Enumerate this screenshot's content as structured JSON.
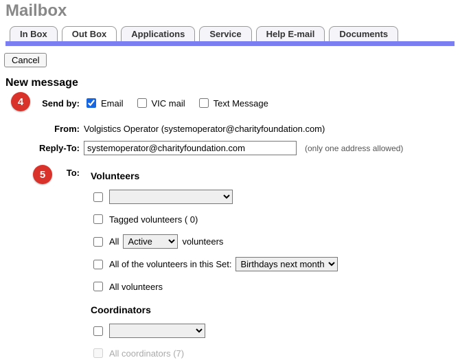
{
  "page_title": "Mailbox",
  "tabs": [
    "In Box",
    "Out Box",
    "Applications",
    "Service",
    "Help E-mail",
    "Documents"
  ],
  "active_tab_index": 1,
  "cancel_label": "Cancel",
  "section_title": "New message",
  "badges": {
    "send_by": "4",
    "to": "5"
  },
  "labels": {
    "send_by": "Send by:",
    "from": "From:",
    "reply_to": "Reply-To:",
    "to": "To:"
  },
  "send_by": {
    "email": {
      "label": "Email",
      "checked": true
    },
    "vic_mail": {
      "label": "VIC mail",
      "checked": false
    },
    "text_message": {
      "label": "Text Message",
      "checked": false
    }
  },
  "from_value": "Volgistics Operator (systemoperator@charityfoundation.com)",
  "reply_to_value": "systemoperator@charityfoundation.com",
  "reply_to_hint": "(only one address allowed)",
  "to": {
    "volunteers_heading": "Volunteers",
    "volunteers_dropdown_selected": "",
    "tagged_label": "Tagged volunteers ( 0)",
    "all_prefix": "All",
    "status_selected": "Active",
    "all_suffix": "volunteers",
    "set_label": "All of the volunteers in this Set:",
    "set_selected": "Birthdays next month",
    "all_volunteers_label": "All volunteers",
    "coordinators_heading": "Coordinators",
    "coordinators_dropdown_selected": "",
    "all_coordinators_label": "All coordinators (7)"
  }
}
